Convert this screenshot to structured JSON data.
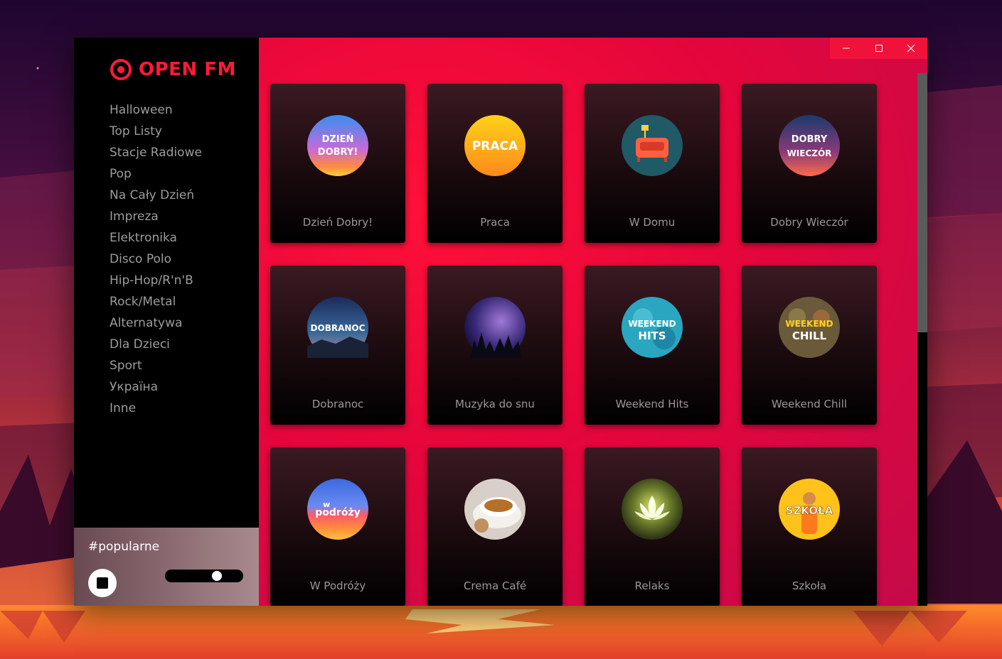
{
  "app": {
    "logo_text": "OPEN FM"
  },
  "sidebar": {
    "items": [
      {
        "label": "Halloween"
      },
      {
        "label": "Top Listy"
      },
      {
        "label": "Stacje Radiowe"
      },
      {
        "label": "Pop"
      },
      {
        "label": "Na Cały Dzień"
      },
      {
        "label": "Impreza"
      },
      {
        "label": "Elektronika"
      },
      {
        "label": "Disco Polo"
      },
      {
        "label": "Hip-Hop/R'n'B"
      },
      {
        "label": "Rock/Metal"
      },
      {
        "label": "Alternatywa"
      },
      {
        "label": "Dla Dzieci"
      },
      {
        "label": "Sport"
      },
      {
        "label": "Україна"
      },
      {
        "label": "Inne"
      }
    ]
  },
  "player": {
    "station": "#popularne",
    "stop_icon": "stop-icon",
    "volume": 0.7
  },
  "window_controls": {
    "minimize_icon": "minimize-icon",
    "maximize_icon": "maximize-icon",
    "close_icon": "close-icon"
  },
  "colors": {
    "accent": "#ff1a3a",
    "content_bg": "#e5063b",
    "sidebar_bg": "#000000",
    "caption": "#9b9597"
  },
  "stations": [
    {
      "name": "Dzień Dobry!",
      "badge": [
        "DZIEŃ",
        "DOBRY!"
      ]
    },
    {
      "name": "Praca",
      "badge": [
        "PRACA"
      ]
    },
    {
      "name": "W Domu",
      "badge": []
    },
    {
      "name": "Dobry Wieczór",
      "badge": [
        "DOBRY",
        "WIECZÓR"
      ]
    },
    {
      "name": "Dobranoc",
      "badge": [
        "DOBRANOC"
      ]
    },
    {
      "name": "Muzyka do snu",
      "badge": []
    },
    {
      "name": "Weekend Hits",
      "badge": [
        "WEEKEND",
        "HITS"
      ]
    },
    {
      "name": "Weekend Chill",
      "badge": [
        "WEEKEND",
        "CHILL"
      ]
    },
    {
      "name": "W Podróży",
      "badge": [
        "w",
        "podróży"
      ]
    },
    {
      "name": "Crema Café",
      "badge": []
    },
    {
      "name": "Relaks",
      "badge": []
    },
    {
      "name": "Szkoła",
      "badge": [
        "SZKOŁA"
      ]
    }
  ]
}
